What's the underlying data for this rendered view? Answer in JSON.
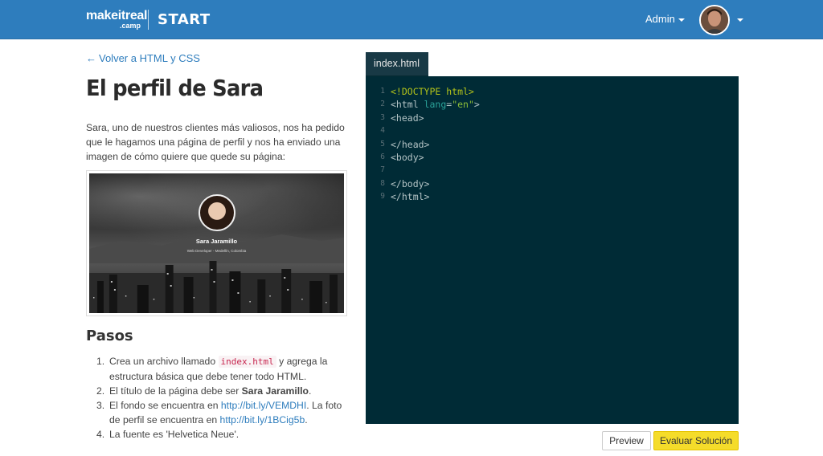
{
  "header": {
    "brand_main": "makeitreal",
    "brand_sub": ".camp",
    "brand_product": "START",
    "admin_label": "Admin",
    "avatar_icon": "user-avatar"
  },
  "colors": {
    "header_bg": "#2e7dbd",
    "link": "#2e7dbd",
    "editor_bg": "#002b36",
    "eval_button": "#f5dc2a"
  },
  "left": {
    "back_link": "Volver a HTML y CSS",
    "title": "El perfil de Sara",
    "intro": "Sara, uno de nuestros clientes más valiosos, nos ha pedido que le hagamos una página de perfil y nos ha enviado una imagen de cómo quiere que quede su página:",
    "profile_preview": {
      "name": "Sara Jaramillo",
      "subtitle": "Web Developer - Medellín, Colombia"
    },
    "steps_title": "Pasos",
    "steps": {
      "s1_num": "1.",
      "s1_a": "Crea un archivo llamado ",
      "s1_code": "index.html",
      "s1_b": " y agrega la estructura básica que debe tener todo HTML.",
      "s2_num": "2.",
      "s2_a": "El título de la página debe ser ",
      "s2_bold": "Sara Jaramillo",
      "s2_b": ".",
      "s3_num": "3.",
      "s3_a": "El fondo se encuentra en ",
      "s3_link1": "http://bit.ly/VEMDHI",
      "s3_b": ". La foto de perfil se encuentra en ",
      "s3_link2": "http://bit.ly/1BCig5b",
      "s3_c": ".",
      "s4_num": "4.",
      "s4_a": "La fuente es 'Helvetica Neue'."
    }
  },
  "editor": {
    "tab_label": "index.html",
    "lines": {
      "n1": "1",
      "n2": "2",
      "n3": "3",
      "n4": "4",
      "n5": "5",
      "n6": "6",
      "n7": "7",
      "n8": "8",
      "n9": "9",
      "l1": "<!DOCTYPE html>",
      "l2_tag": "<html ",
      "l2_attr": "lang",
      "l2_eq": "=",
      "l2_val": "\"en\"",
      "l2_end": ">",
      "l3": "<head>",
      "l5": "</head>",
      "l6": "<body>",
      "l8": "</body>",
      "l9": "</html>"
    }
  },
  "buttons": {
    "preview": "Preview",
    "evaluate": "Evaluar Solución"
  }
}
